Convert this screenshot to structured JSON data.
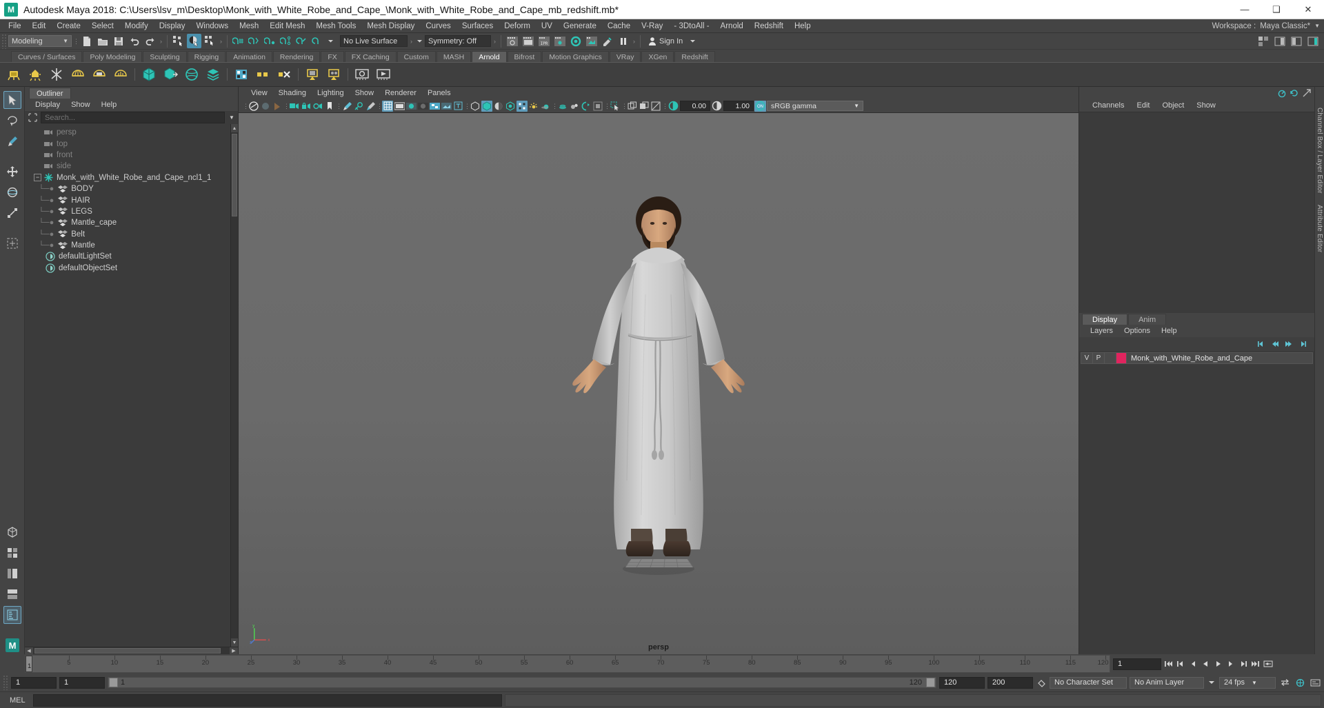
{
  "titlebar": {
    "app_title": "Autodesk Maya 2018: C:\\Users\\lsv_m\\Desktop\\Monk_with_White_Robe_and_Cape_\\Monk_with_White_Robe_and_Cape_mb_redshift.mb*",
    "logo_text": "M",
    "minimize": "—",
    "maximize": "❑",
    "close": "✕"
  },
  "menubar": {
    "items": [
      "File",
      "Edit",
      "Create",
      "Select",
      "Modify",
      "Display",
      "Windows",
      "Mesh",
      "Edit Mesh",
      "Mesh Tools",
      "Mesh Display",
      "Curves",
      "Surfaces",
      "Deform",
      "UV",
      "Generate",
      "Cache",
      "V-Ray",
      "- 3DtoAll -",
      "Arnold",
      "Redshift",
      "Help"
    ],
    "workspace_label": "Workspace :",
    "workspace_value": "Maya Classic*"
  },
  "statusbar": {
    "menuset": "Modeling",
    "live_surface": "No Live Surface",
    "symmetry": "Symmetry: Off",
    "sign_in": "Sign In"
  },
  "shelf": {
    "tabs": [
      "Curves / Surfaces",
      "Poly Modeling",
      "Sculpting",
      "Rigging",
      "Animation",
      "Rendering",
      "FX",
      "FX Caching",
      "Custom",
      "MASH",
      "Arnold",
      "Bifrost",
      "Motion Graphics",
      "VRay",
      "XGen",
      "Redshift"
    ],
    "active_tab": "Arnold"
  },
  "outliner": {
    "tab_label": "Outliner",
    "menus": [
      "Display",
      "Show",
      "Help"
    ],
    "search_placeholder": "Search...",
    "search_value": "",
    "items": [
      {
        "label": "persp",
        "icon": "camera-icon",
        "depth": 1,
        "dim": true
      },
      {
        "label": "top",
        "icon": "camera-icon",
        "depth": 1,
        "dim": true
      },
      {
        "label": "front",
        "icon": "camera-icon",
        "depth": 1,
        "dim": true
      },
      {
        "label": "side",
        "icon": "camera-icon",
        "depth": 1,
        "dim": true
      },
      {
        "label": "Monk_with_White_Robe_and_Cape_ncl1_1",
        "icon": "nucleus-icon",
        "depth": 0,
        "dim": false,
        "expanded": true
      },
      {
        "label": "BODY",
        "icon": "mesh-icon",
        "depth": 2,
        "dim": false
      },
      {
        "label": "HAIR",
        "icon": "mesh-icon",
        "depth": 2,
        "dim": false
      },
      {
        "label": "LEGS",
        "icon": "mesh-icon",
        "depth": 2,
        "dim": false
      },
      {
        "label": "Mantle_cape",
        "icon": "mesh-icon",
        "depth": 2,
        "dim": false
      },
      {
        "label": "Belt",
        "icon": "mesh-icon",
        "depth": 2,
        "dim": false
      },
      {
        "label": "Mantle",
        "icon": "mesh-icon",
        "depth": 2,
        "dim": false,
        "last": true
      },
      {
        "label": "defaultLightSet",
        "icon": "set-icon",
        "depth": 1,
        "dim": false
      },
      {
        "label": "defaultObjectSet",
        "icon": "set-icon",
        "depth": 1,
        "dim": false
      }
    ]
  },
  "viewport": {
    "menus": [
      "View",
      "Shading",
      "Lighting",
      "Show",
      "Renderer",
      "Panels"
    ],
    "exposure_value": "0.00",
    "gamma_value": "1.00",
    "view_transform": "sRGB gamma",
    "camera_label": "persp",
    "axis": {
      "x": "x",
      "y": "y",
      "z": "z"
    }
  },
  "channelbox": {
    "tabs": [
      "Channels",
      "Edit",
      "Object",
      "Show"
    ],
    "vertical_tabs": [
      "Channel Box / Layer Editor",
      "Attribute Editor"
    ]
  },
  "layer_editor": {
    "tabs": [
      "Display",
      "Anim"
    ],
    "active_tab": "Display",
    "menus": [
      "Layers",
      "Options",
      "Help"
    ],
    "columns": [
      "V",
      "P"
    ],
    "layers": [
      {
        "visible": "V",
        "playback": "P",
        "color": "#e0245e",
        "name": "Monk_with_White_Robe_and_Cape"
      }
    ]
  },
  "timeline": {
    "current_frame": "1",
    "ticks": [
      1,
      5,
      10,
      15,
      20,
      25,
      30,
      35,
      40,
      45,
      50,
      55,
      60,
      65,
      70,
      75,
      80,
      85,
      90,
      95,
      100,
      105,
      110,
      115,
      120
    ],
    "frame_field": "1"
  },
  "range": {
    "anim_start": "1",
    "range_start": "1",
    "slider_start_label": "1",
    "slider_end_label": "120",
    "range_end": "120",
    "anim_end": "200",
    "character_set": "No Character Set",
    "anim_layer": "No Anim Layer",
    "fps": "24 fps"
  },
  "command_line": {
    "label": "MEL",
    "value": ""
  },
  "colors": {
    "accent_teal": "#2ec4b6",
    "highlight_blue": "#5f9cba",
    "layer_swatch": "#e0245e",
    "panel_bg": "#3b3b3b",
    "viewport_bg": "#6a6a6a"
  }
}
